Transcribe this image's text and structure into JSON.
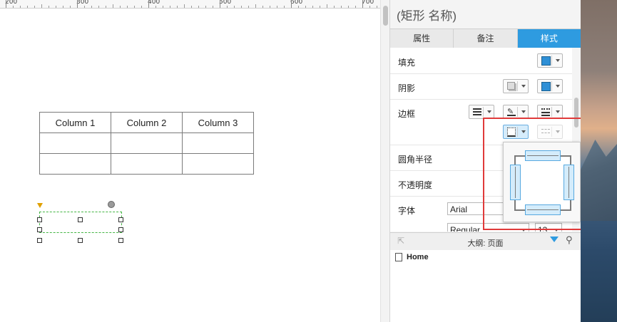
{
  "ruler": {
    "labels": [
      "200",
      "300",
      "400",
      "500",
      "600",
      "700"
    ]
  },
  "canvas": {
    "table": {
      "headers": [
        "Column 1",
        "Column 2",
        "Column 3"
      ],
      "rows": [
        [
          "",
          "",
          ""
        ],
        [
          "",
          "",
          ""
        ]
      ]
    }
  },
  "panel": {
    "title": "(矩形 名称)",
    "tabs": [
      {
        "label": "属性",
        "active": false
      },
      {
        "label": "备注",
        "active": false
      },
      {
        "label": "样式",
        "active": true
      }
    ],
    "props": {
      "fill": {
        "label": "填充",
        "color": "#2e8fd6"
      },
      "shadow": {
        "label": "阴影"
      },
      "border": {
        "label": "边框"
      },
      "corner_radius": {
        "label": "圆角半径"
      },
      "opacity": {
        "label": "不透明度"
      },
      "font": {
        "label": "字体",
        "family": "Arial",
        "style": "Regular",
        "size": "13"
      }
    },
    "outline": {
      "title": "大纲: 页面",
      "items": [
        {
          "label": "Home"
        }
      ]
    }
  },
  "colors": {
    "accent": "#2e9be0",
    "highlight": "#e03a3a",
    "selection": "#44b544"
  }
}
